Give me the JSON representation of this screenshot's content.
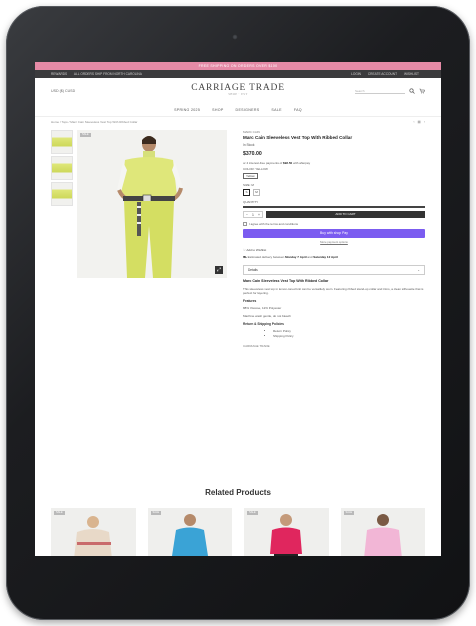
{
  "store": {
    "promo_text": "FREE SHIPPING ON ORDERS OVER $100",
    "topbar_left": [
      "REWARDS",
      "ALL ORDERS SHIP FROM NORTH CAROLINA"
    ],
    "topbar_right": [
      "LOGIN",
      "CREATE ACCOUNT",
      "WISHLIST"
    ],
    "currency": "USD ($) CUSD",
    "logo_main": "CARRIAGE TRADE",
    "logo_sub": "SHOP · EST",
    "search_placeholder": "Search",
    "nav": [
      "SPRING 2025",
      "SHOP",
      "DESIGNERS",
      "SALE",
      "FAQ"
    ],
    "breadcrumb": "Home / Tops / Marc Cain Sleeveless Vest Top With Ribbed Collar"
  },
  "product": {
    "badge": "SALE",
    "vendor": "MARC CAIN",
    "title": "Marc Cain Sleeveless Vest Top With Ribbed Collar",
    "stock": "In Stock",
    "price": "$370.00",
    "afterpay_prefix": "or 4 interest-free payments of",
    "afterpay_amount": "$92.50",
    "afterpay_suffix": "with afterpay",
    "color_label": "COLOR: YELLOW",
    "color_value": "Yellow",
    "size_label": "SIZE: M",
    "sizes": [
      "S",
      "M"
    ],
    "qty_label": "QUANTITY",
    "qty_value": "1",
    "add_to_cart": "ADD TO CART",
    "terms": "I agree with the terms and conditions",
    "shop_pay": "Buy with shop Pay",
    "more_payment": "More payment options",
    "wishlist": "Add to Wishlist",
    "delivery_prefix": "Estimated delivery between",
    "delivery_from": "Monday 7 April",
    "delivery_and": "and",
    "delivery_to": "Saturday 12 April",
    "details_label": "Details",
    "desc_title": "Marc Cain Sleeveless Vest Top With Ribbed Collar",
    "desc_body": "This sleeveless vest top in lemon-toned knit can be versatilely worn. Featuring ribbed stand-up collar and trims, a clean silhouette that is perfect for layering.",
    "features_h": "Features",
    "features_line": "88% Viscose, 12% Polyester",
    "care_line": "Machine wash gentle, do not bleach",
    "returns_h": "Return & Shipping Policies",
    "bullets": [
      "Return Policy",
      "Shipping Policy"
    ],
    "sku": "CARRIAGE TRADE"
  },
  "related": {
    "title": "Related Products",
    "badges": [
      "SALE",
      "SALE",
      "SALE",
      "SALE"
    ]
  },
  "colors": {
    "accent_pink": "#e58aa6",
    "shop_pay": "#7b5cf0",
    "garment": "#dfe77a"
  }
}
